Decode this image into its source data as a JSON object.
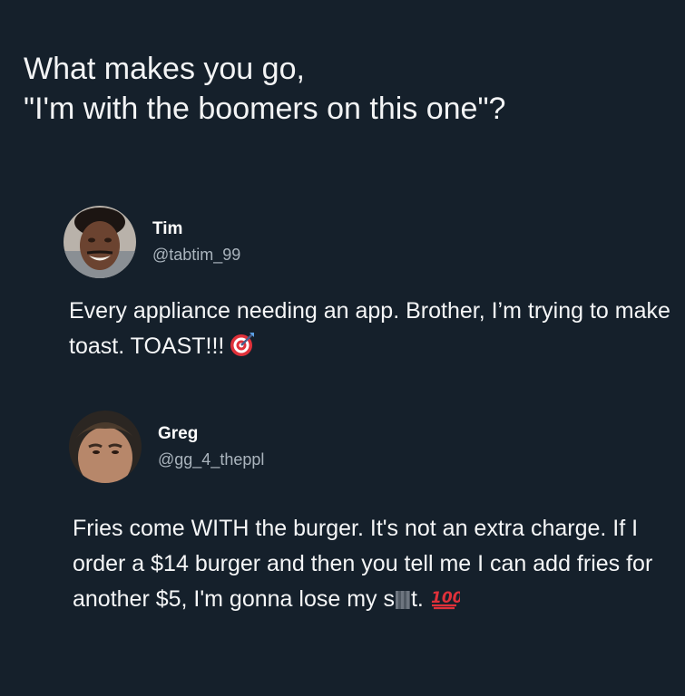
{
  "title": {
    "line1": "What makes you go,",
    "line2": "\"I'm with the boomers on this one\"?"
  },
  "tweets": [
    {
      "name": "Tim",
      "handle": "@tabtim_99",
      "text": "Every appliance needing an app. Brother, I’m trying to make toast. TOAST!!!",
      "emoji": "direct-hit-icon"
    },
    {
      "name": "Greg",
      "handle": "@gg_4_theppl",
      "text_part1": "Fries come WITH the burger. It's not an extra charge. If I order a $14 burger and then you tell me I can add fries for another $5, I'm gonna lose my s",
      "text_part2": "t.",
      "emoji": "hundred-points-icon"
    }
  ],
  "colors": {
    "background": "#15202b",
    "text": "#ffffff",
    "handle": "#aab4bd"
  }
}
